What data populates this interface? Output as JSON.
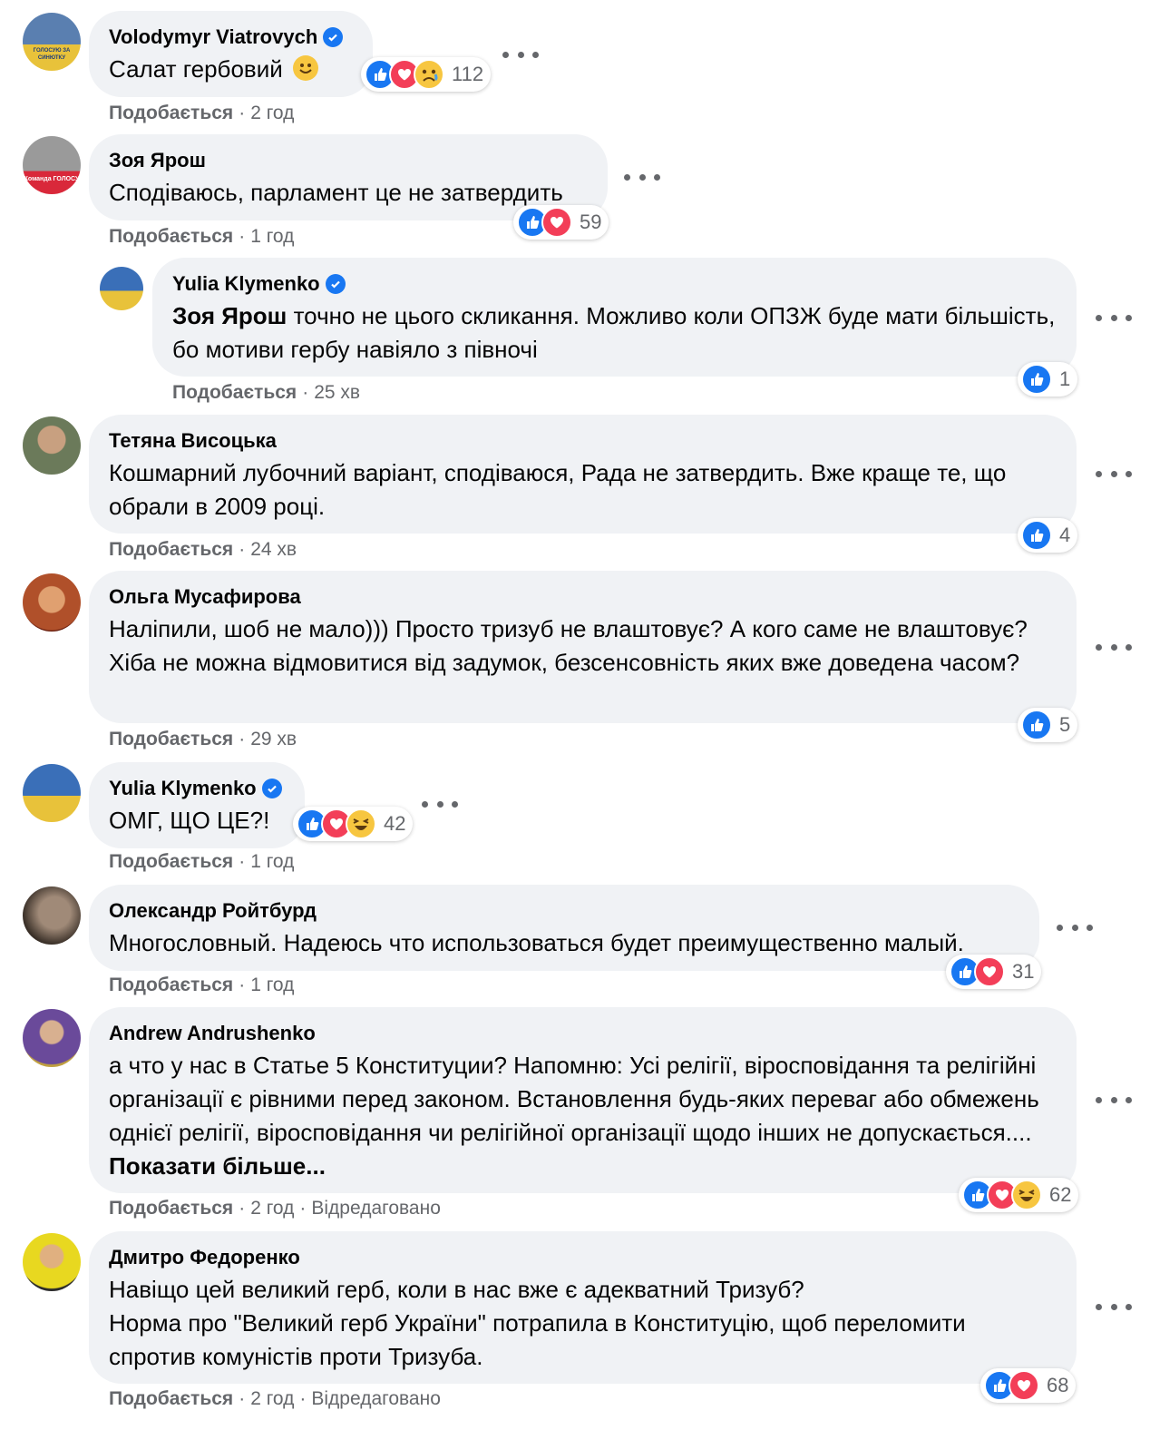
{
  "labels": {
    "like": "Подобається",
    "edited": "Відредаговано",
    "see_more": "Показати більше..."
  },
  "comments": [
    {
      "author": "Volodymyr Viatrovych",
      "verified": true,
      "text": "Салат гербовий",
      "time": "2 год",
      "reactions": [
        "like",
        "love",
        "sad"
      ],
      "count": "112",
      "avatar_colors": [
        "#5a7fb0",
        "#e8c23a"
      ],
      "avatar_caption": "ГОЛОСУЮ ЗА СИНЮТКУ"
    },
    {
      "author": "Зоя Ярош",
      "verified": false,
      "text": "Сподіваюсь, парламент це не затвердить",
      "time": "1 год",
      "reactions": [
        "like",
        "love"
      ],
      "count": "59",
      "avatar_colors": [
        "#8a8a8a",
        "#d9283a"
      ],
      "avatar_caption": "Команда ГОЛОСУ"
    },
    {
      "author": "Yulia Klymenko",
      "verified": true,
      "mention": "Зоя Ярош",
      "text": " точно не цього скликання. Можливо коли ОПЗЖ буде мати більшість, бо мотиви гербу навіяло з півночі",
      "time": "25 хв",
      "reactions": [
        "like"
      ],
      "count": "1",
      "avatar_colors": [
        "#3a6fb8",
        "#e8c23a"
      ],
      "reply": true
    },
    {
      "author": "Тетяна Висоцька",
      "verified": false,
      "text": "Кошмарний лубочний варіант, сподіваюся, Рада не затвердить. Вже краще те, що обрали в 2009 році.",
      "time": "24 хв",
      "reactions": [
        "like"
      ],
      "count": "4",
      "avatar_colors": [
        "#6b7a5a",
        "#2a2a2a"
      ]
    },
    {
      "author": "Ольга Мусафирова",
      "verified": false,
      "text": "Наліпили, шоб не мало))) Просто тризуб не влаштовує? А кого саме не влаштовує? Хіба не можна відмовитися від задумок, безсенсовність яких вже доведена часом?",
      "time": "29 хв",
      "reactions": [
        "like"
      ],
      "count": "5",
      "avatar_colors": [
        "#b0502a",
        "#6a2010"
      ]
    },
    {
      "author": "Yulia Klymenko",
      "verified": true,
      "text": "ОМГ, ЩО ЦЕ?!",
      "time": "1 год",
      "reactions": [
        "like",
        "love",
        "haha"
      ],
      "count": "42",
      "avatar_colors": [
        "#3a6fb8",
        "#e8c23a"
      ]
    },
    {
      "author": "Олександр Ройтбурд",
      "verified": false,
      "text": "Многословный. Надеюсь что использоваться будет преимущественно малый.",
      "time": "1 год",
      "reactions": [
        "like",
        "love"
      ],
      "count": "31",
      "avatar_colors": [
        "#7a6a5a",
        "#3a3028"
      ]
    },
    {
      "author": "Andrew Andrushenko",
      "verified": false,
      "text": "а что у нас в Статье 5 Конституции? Напомню: Усі релігії, віросповідання та релігійні організації є рівними перед законом. Встановлення будь-яких переваг або обмежень однієї релігії, віросповідання чи релігійної організації щодо інших не допускається....",
      "see_more": true,
      "time": "2 год",
      "edited": true,
      "reactions": [
        "like",
        "love",
        "haha"
      ],
      "count": "62",
      "avatar_colors": [
        "#6a4a9a",
        "#c0a040"
      ]
    },
    {
      "author": "Дмитро Федоренко",
      "verified": false,
      "text": "Навіщо цей великий герб, коли в нас вже є адекватний Тризуб?\nНорма про \"Великий герб України\" потрапила в Конституцію, щоб переломити спротив комуністів проти Тризуба.",
      "time": "2 год",
      "edited": true,
      "reactions": [
        "like",
        "love"
      ],
      "count": "68",
      "avatar_colors": [
        "#e8d820",
        "#2a2a2a"
      ]
    }
  ]
}
